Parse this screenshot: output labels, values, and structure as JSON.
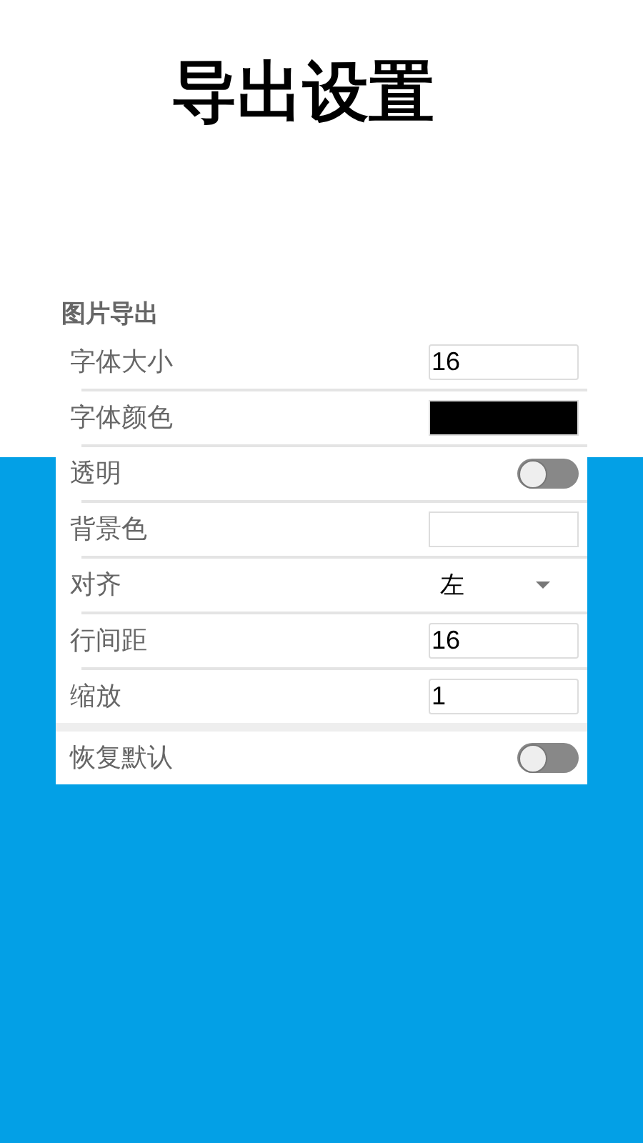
{
  "title": "导出设置",
  "section": "图片导出",
  "rows": [
    {
      "kind": "input",
      "label": "字体大小",
      "value": "16"
    },
    {
      "kind": "color",
      "label": "字体颜色",
      "color": "#000000"
    },
    {
      "kind": "toggle",
      "label": "透明",
      "on": false
    },
    {
      "kind": "color",
      "label": "背景色",
      "color": "#ffffff"
    },
    {
      "kind": "select",
      "label": "对齐",
      "value": "左"
    },
    {
      "kind": "input",
      "label": "行间距",
      "value": "16"
    },
    {
      "kind": "input",
      "label": "缩放",
      "value": "1"
    },
    {
      "kind": "toggle",
      "label": "恢复默认",
      "on": false,
      "separated": true
    }
  ]
}
